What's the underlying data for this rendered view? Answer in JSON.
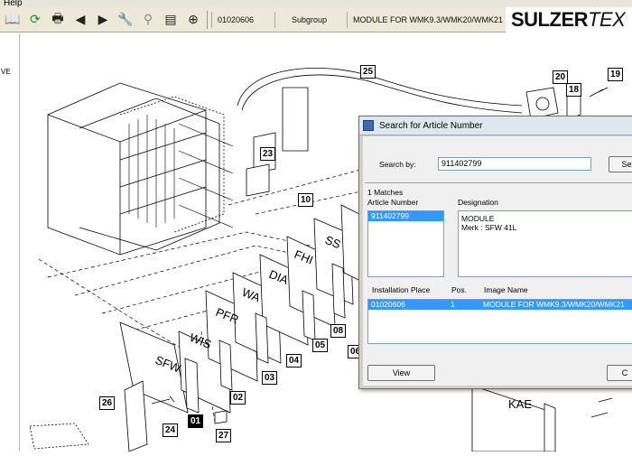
{
  "menubar": {
    "item": "Help"
  },
  "toolbar": {
    "icons": [
      "open-book-icon",
      "refresh-icon",
      "print-icon",
      "back-arrow-icon",
      "forward-arrow-icon",
      "wrench-icon",
      "search-magnifier-icon",
      "document-icon",
      "binoculars-icon"
    ],
    "article_number": "01020606",
    "level": "Subgroup",
    "description": "MODULE FOR WMK9.3/WMK20/WMK21"
  },
  "brand": {
    "logo_bold": "SULZER",
    "logo_light": "TEX"
  },
  "left_panel": {
    "text": "VE"
  },
  "drawing": {
    "callouts": [
      {
        "id": "25",
        "label": "25"
      },
      {
        "id": "20",
        "label": "20"
      },
      {
        "id": "18",
        "label": "18"
      },
      {
        "id": "19",
        "label": "19"
      },
      {
        "id": "23",
        "label": "23"
      },
      {
        "id": "10",
        "label": "10"
      },
      {
        "id": "08",
        "label": "08"
      },
      {
        "id": "05",
        "label": "05"
      },
      {
        "id": "06",
        "label": "06"
      },
      {
        "id": "04",
        "label": "04"
      },
      {
        "id": "03",
        "label": "03"
      },
      {
        "id": "02",
        "label": "02"
      },
      {
        "id": "01",
        "label": "01"
      },
      {
        "id": "26",
        "label": "26"
      },
      {
        "id": "24",
        "label": "24"
      },
      {
        "id": "27",
        "label": "27"
      }
    ],
    "panel_labels": [
      "SFW",
      "WIS",
      "PFR",
      "WA",
      "DIA",
      "FHI",
      "SS",
      "KAE"
    ]
  },
  "dialog": {
    "title": "Search for Article Number",
    "search_label": "Search by:",
    "search_value": "911402799",
    "search_button": "Se",
    "matches_label": "1 Matches",
    "article_number_header": "Article Number",
    "designation_header": "Designation",
    "article_list": [
      "911402799"
    ],
    "designation_lines": [
      "MODULE",
      "Merk : SFW 41L"
    ],
    "installation_header": "Installation Place",
    "pos_header": "Pos.",
    "image_name_header": "Image Name",
    "installation_rows": [
      {
        "place": "01020606",
        "pos": "1",
        "image": "MODULE FOR WMK9.3/WMK20/WMK21"
      }
    ],
    "view_button": "View",
    "close_button": "C"
  }
}
